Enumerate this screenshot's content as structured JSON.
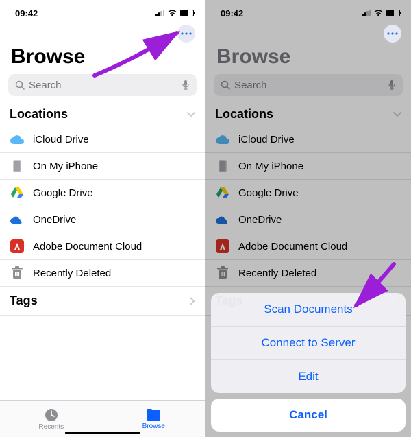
{
  "status": {
    "time": "09:42"
  },
  "page_title": "Browse",
  "search": {
    "placeholder": "Search"
  },
  "sections": {
    "locations_header": "Locations",
    "tags_header": "Tags"
  },
  "locations": [
    {
      "label": "iCloud Drive",
      "icon": "cloud-icon",
      "color": "#46aef7"
    },
    {
      "label": "On My iPhone",
      "icon": "device-icon",
      "color": "#9ea1a6"
    },
    {
      "label": "Google Drive",
      "icon": "gdrive-icon",
      "color": "#ffcc00"
    },
    {
      "label": "OneDrive",
      "icon": "onedrive-icon",
      "color": "#1e6fd9"
    },
    {
      "label": "Adobe Document Cloud",
      "icon": "adobe-icon",
      "color": "#d93025"
    },
    {
      "label": "Recently Deleted",
      "icon": "trash-icon",
      "color": "#8e8e93"
    }
  ],
  "tabs": {
    "recents": "Recents",
    "browse": "Browse"
  },
  "action_sheet": {
    "items": [
      "Scan Documents",
      "Connect to Server",
      "Edit"
    ],
    "cancel": "Cancel"
  }
}
